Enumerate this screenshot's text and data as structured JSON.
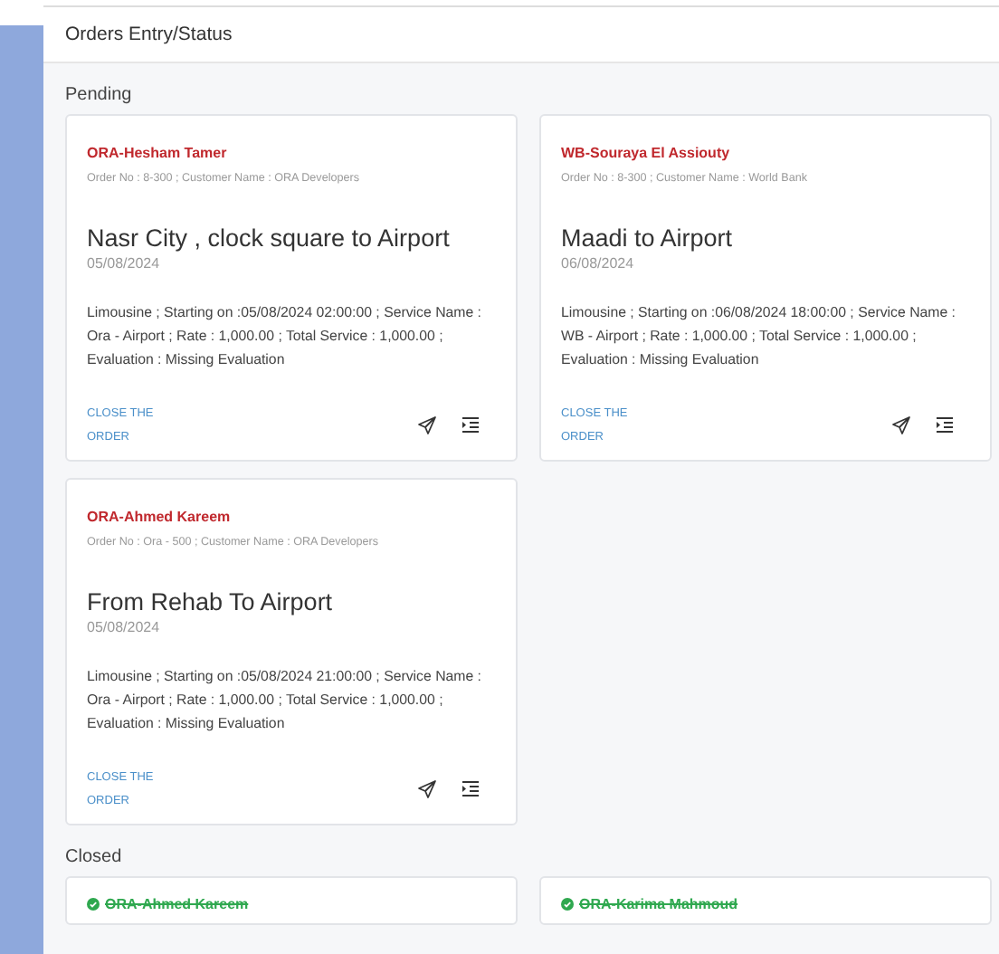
{
  "window": {
    "title": "Orders Entry/Status"
  },
  "sections": [
    {
      "title": "Pending",
      "orders": [
        {
          "closed": false,
          "name": "ORA-Hesham Tamer",
          "info": "Order No : 8-300 ; Customer Name : ORA Developers",
          "route": "Nasr City , clock square to Airport",
          "date": "05/08/2024",
          "details": "Limousine ; Starting on :05/08/2024 02:00:00 ; Service Name : Ora - Airport ; Rate : 1,000.00 ; Total Service : 1,000.00 ; Evaluation : Missing Evaluation",
          "action": "CLOSE THE ORDER"
        },
        {
          "closed": false,
          "name": "WB-Souraya El Assiouty",
          "info": "Order No : 8-300 ; Customer Name : World Bank",
          "route": "Maadi to Airport",
          "date": "06/08/2024",
          "details": "Limousine ; Starting on :06/08/2024 18:00:00 ; Service Name : WB - Airport ; Rate : 1,000.00 ; Total Service : 1,000.00 ; Evaluation : Missing Evaluation",
          "action": "CLOSE THE ORDER"
        },
        {
          "closed": false,
          "name": "ORA-Ahmed Kareem",
          "info": "Order No : Ora - 500 ; Customer Name : ORA Developers",
          "route": "From Rehab To Airport",
          "date": "05/08/2024",
          "details": "Limousine ; Starting on :05/08/2024 21:00:00 ; Service Name : Ora - Airport ; Rate : 1,000.00 ; Total Service : 1,000.00 ; Evaluation : Missing Evaluation",
          "action": "CLOSE THE ORDER"
        }
      ]
    },
    {
      "title": "Closed",
      "orders": [
        {
          "closed": true,
          "name": "ORA-Ahmed Kareem"
        },
        {
          "closed": true,
          "name": "ORA-Karima Mahmoud"
        }
      ]
    }
  ]
}
